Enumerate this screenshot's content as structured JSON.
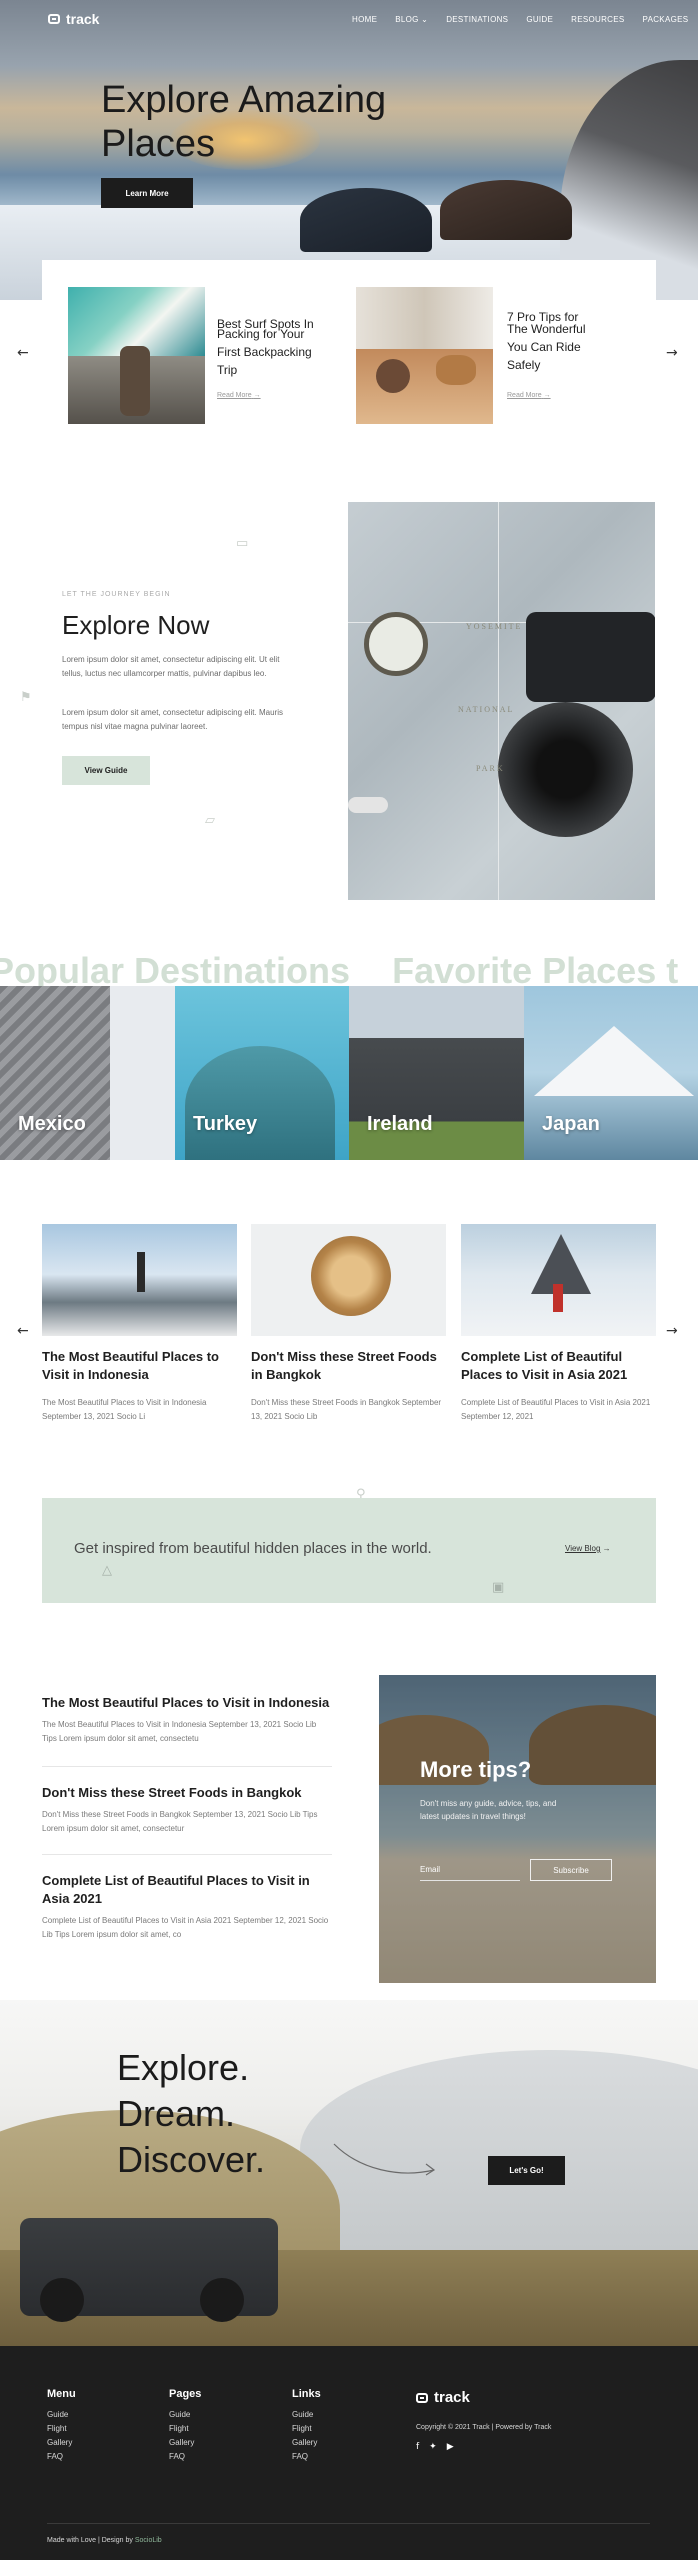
{
  "brand": {
    "name": "track"
  },
  "nav": [
    {
      "label": "HOME"
    },
    {
      "label": "BLOG"
    },
    {
      "label": "DESTINATIONS"
    },
    {
      "label": "GUIDE"
    },
    {
      "label": "RESOURCES"
    },
    {
      "label": "PACKAGES"
    }
  ],
  "hero": {
    "title_line1": "Explore Amazing",
    "title_line2": "Places",
    "cta": "Learn More"
  },
  "slider": {
    "cards": [
      {
        "title_line1": "Best Surf Spots In",
        "title_line2": "Packing for Your",
        "title_line3": "First Backpacking",
        "title_line4": "Trip",
        "read_more": "Read More"
      },
      {
        "title_line1": "7 Pro Tips for",
        "title_line2": "The Wonderful",
        "title_line3": "You Can Ride",
        "title_line4": "Safely",
        "read_more": "Read More"
      }
    ]
  },
  "explore": {
    "eyebrow": "LET THE JOURNEY BEGIN",
    "title": "Explore Now",
    "para1": "Lorem ipsum dolor sit amet, consectetur adipiscing elit. Ut elit tellus, luctus nec ullamcorper mattis, pulvinar dapibus leo.",
    "para2": "Lorem ipsum dolor sit amet, consectetur adipiscing elit. Mauris tempus nisl vitae magna pulvinar laoreet.",
    "cta": "View Guide",
    "map_words": [
      "YOSEMITE",
      "NATIONAL",
      "PARK"
    ]
  },
  "destinations": {
    "marquee1": "Popular Destinations",
    "marquee2": "Favorite Places t",
    "items": [
      {
        "label": "Mexico"
      },
      {
        "label": "Turkey"
      },
      {
        "label": "Ireland"
      },
      {
        "label": "Japan"
      }
    ]
  },
  "blog": {
    "cards": [
      {
        "title": "The Most Beautiful Places to Visit in Indonesia",
        "meta": "The Most Beautiful Places to Visit in Indonesia September 13, 2021 Socio Li"
      },
      {
        "title": "Don't Miss these Street Foods in Bangkok",
        "meta": "Don't Miss these Street Foods in Bangkok September 13, 2021 Socio Lib"
      },
      {
        "title": "Complete List of Beautiful Places to Visit in Asia 2021",
        "meta": "Complete List of Beautiful Places to Visit in Asia 2021 September 12, 2021"
      }
    ]
  },
  "banner": {
    "text": "Get inspired from beautiful hidden places in the world.",
    "link": "View Blog"
  },
  "list": {
    "items": [
      {
        "title": "The Most Beautiful Places to Visit in Indonesia",
        "meta": "The Most Beautiful Places to Visit in Indonesia September 13, 2021 Socio Lib Tips Lorem ipsum dolor sit amet, consectetu"
      },
      {
        "title": "Don't Miss these Street Foods in Bangkok",
        "meta": "Don't Miss these Street Foods in Bangkok September 13, 2021 Socio Lib Tips Lorem ipsum dolor sit amet, consectetur"
      },
      {
        "title": "Complete List of Beautiful Places to Visit in Asia 2021",
        "meta": "Complete List of Beautiful Places to Visit in Asia 2021 September 12, 2021 Socio Lib Tips Lorem ipsum dolor sit amet, co"
      }
    ]
  },
  "tips": {
    "title": "More tips?",
    "text": "Don't miss any guide, advice, tips, and latest updates in travel things!",
    "email_placeholder": "Email",
    "subscribe": "Subscribe"
  },
  "discover": {
    "line1": "Explore.",
    "line2": "Dream.",
    "line3": "Discover.",
    "cta": "Let's Go!"
  },
  "footer": {
    "columns": [
      {
        "heading": "Menu",
        "links": [
          "Guide",
          "Flight",
          "Gallery",
          "FAQ"
        ]
      },
      {
        "heading": "Pages",
        "links": [
          "Guide",
          "Flight",
          "Gallery",
          "FAQ"
        ]
      },
      {
        "heading": "Links",
        "links": [
          "Guide",
          "Flight",
          "Gallery",
          "FAQ"
        ]
      }
    ],
    "brand": "track",
    "copyright": "Copyright © 2021 Track | Powered by Track",
    "credit_prefix": "Made with Love | Design by",
    "credit_link": "SocioLib"
  },
  "colors": {
    "mint": "#d7e4da",
    "dark": "#1c1c1c",
    "footer": "#1e1e1e"
  }
}
